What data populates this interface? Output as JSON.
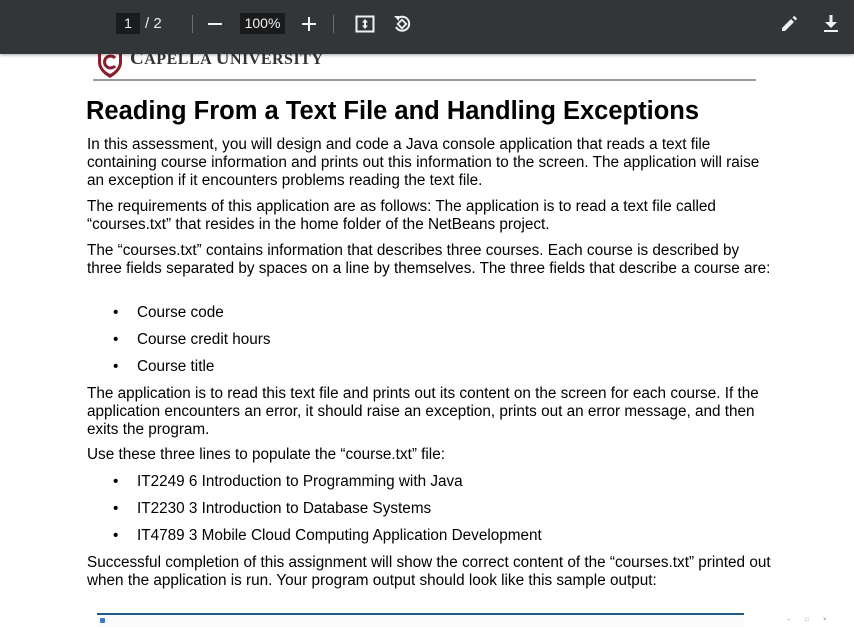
{
  "toolbar": {
    "current_page": "1",
    "page_separator": "/ 2",
    "zoom": "100%"
  },
  "icons": {
    "zoom_out": "minus-icon",
    "zoom_in": "plus-icon",
    "fit": "fit-to-page-icon",
    "rotate": "rotate-icon",
    "edit": "pencil-icon",
    "download": "download-icon"
  },
  "document": {
    "logo_first": "C",
    "logo_rest1": "APELLA ",
    "logo_big2": "U",
    "logo_rest2": "NIVERSITY",
    "title": "Reading From a Text File and Handling Exceptions",
    "para1": "In this assessment, you will design and code a Java console application that reads a text file containing course information and prints out this information to the screen. The application will raise an exception if it encounters problems reading the text file.",
    "para2": "The requirements of this application are as follows: The application is to read a text file called “courses.txt” that resides in the home folder of the NetBeans project.",
    "para3": "The “courses.txt” contains information that describes three courses. Each course is described by three fields separated by spaces on a line by themselves. The three fields that describe a course are:",
    "fields": [
      "Course code",
      "Course credit hours",
      "Course title"
    ],
    "para4": "The application is to read this text file and prints out its content on the screen for each course. If the application encounters an error, it should raise an exception, prints out an error message, and then exits the program.",
    "para5": "Use these three lines to populate the “course.txt” file:",
    "lines": [
      "IT2249 6 Introduction to Programming with Java",
      "IT2230 3 Introduction to Database Systems",
      "IT4789 3 Mobile Cloud Computing Application Development"
    ],
    "para6": "Successful completion of this assignment will show the correct content of the “courses.txt” printed out when the application is run. Your program output should look like this sample output:",
    "bullet_char": "•"
  },
  "colors": {
    "toolbar_bg": "#323639",
    "logo_red": "#8a1c2b"
  }
}
